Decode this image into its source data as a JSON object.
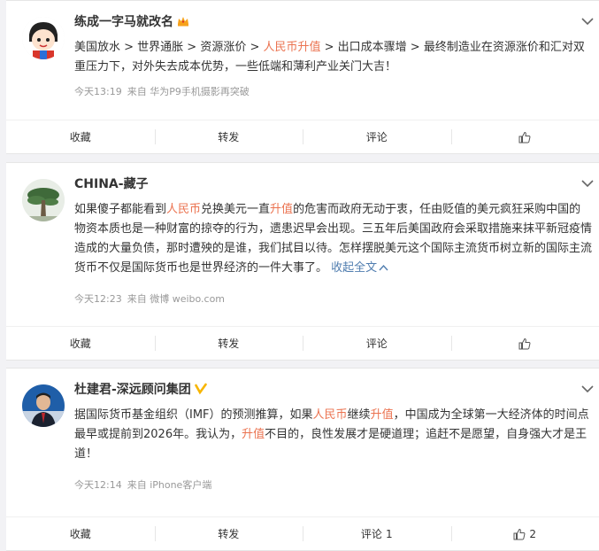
{
  "posts": [
    {
      "author": "练成一字马就改名",
      "content": [
        {
          "t": "美国放水 > 世界通胀 > 资源涨价 > ",
          "hl": false
        },
        {
          "t": "人民币升值",
          "hl": true
        },
        {
          "t": " > 出口成本骤增 > 最终制造业在资源涨价和汇对双重压力下，对外失去成本优势，一些低端和薄利产业关门大吉！",
          "hl": false
        }
      ],
      "time": "今天13:19",
      "source": "来自 华为P9手机摄影再突破",
      "actions": {
        "fav": "收藏",
        "repost": "转发",
        "comment": "评论",
        "comment_count": "",
        "like_count": ""
      }
    },
    {
      "author": "CHINA-藏子",
      "content": [
        {
          "t": "如果傻子都能看到",
          "hl": false
        },
        {
          "t": "人民币",
          "hl": true
        },
        {
          "t": "兑换美元一直",
          "hl": false
        },
        {
          "t": "升值",
          "hl": true
        },
        {
          "t": "的危害而政府无动于衷，任由贬值的美元疯狂采购中国的物资本质也是一种财富的掠夺的行为，遗患迟早会出现。三五年后美国政府会采取措施来抹平新冠疫情造成的大量负债，那时遭殃的是谁，我们拭目以待。怎样摆脱美元这个国际主流货币树立新的国际主流货币不仅是国际货币也是世界经济的一件大事了。",
          "hl": false
        }
      ],
      "collapse": "收起全文",
      "time": "今天12:23",
      "source": "来自 微博 weibo.com",
      "actions": {
        "fav": "收藏",
        "repost": "转发",
        "comment": "评论",
        "comment_count": "",
        "like_count": ""
      }
    },
    {
      "author": "杜建君-深远顾问集团",
      "content": [
        {
          "t": "据国际货币基金组织（IMF）的预测推算，如果",
          "hl": false
        },
        {
          "t": "人民币",
          "hl": true
        },
        {
          "t": "继续",
          "hl": false
        },
        {
          "t": "升值",
          "hl": true
        },
        {
          "t": "，中国成为全球第一大经济体的时间点最早或提前到2026年。我认为，",
          "hl": false
        },
        {
          "t": "升值",
          "hl": true
        },
        {
          "t": "不目的，良性发展才是硬道理；追赶不是愿望，自身强大才是王道！",
          "hl": false
        }
      ],
      "time": "今天12:14",
      "source": "来自 iPhone客户端",
      "actions": {
        "fav": "收藏",
        "repost": "转发",
        "comment": "评论",
        "comment_count": "1",
        "like_count": "2"
      }
    }
  ],
  "colors": {
    "highlight": "#eb7350",
    "link": "#507daf",
    "verified": "#f7b500"
  }
}
